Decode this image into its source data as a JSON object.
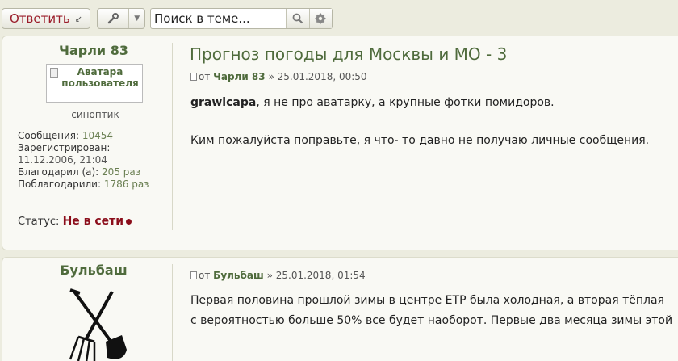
{
  "toolbar": {
    "reply_label": "Ответить",
    "search_placeholder": "Поиск в теме..."
  },
  "posts": [
    {
      "author": "Чарли 83",
      "avatar_alt": "Аватара пользователя",
      "rank": "синоптик",
      "stats": {
        "messages_label": "Сообщения:",
        "messages": "10454",
        "registered_label": "Зарегистрирован:",
        "registered": "11.12.2006, 21:04",
        "thanked_label": "Благодарил (а):",
        "thanked": "205 раз",
        "was_thanked_label": "Поблагодарили:",
        "was_thanked": "1786 раз"
      },
      "status_label": "Статус:",
      "status": "Не в сети",
      "title": "Прогноз погоды для Москвы и МО - 3",
      "meta_from": "от",
      "meta_author": "Чарли 83",
      "meta_date": "» 25.01.2018, 00:50",
      "mention": "grawicapa",
      "line1": ", я не про аватарку, а крупные фотки помидоров.",
      "line2": "Ким пожалуйста поправьте, я что- то давно не получаю личные сообщения."
    },
    {
      "author": "Бульбаш",
      "meta_from": "от",
      "meta_author": "Бульбаш",
      "meta_date": "» 25.01.2018, 01:54",
      "line1": "Первая половина прошлой зимы в центре ЕТР была холодная, а вторая тёплая",
      "line2": "с вероятностью больше 50% все будет наоборот. Первые два месяца зимы этой"
    }
  ],
  "colors": {
    "background": "#ececdf",
    "post_bg": "#f9f9f4",
    "username": "#4f6b3c",
    "offline": "#8b0d1a",
    "reply": "#9a1c2a"
  }
}
